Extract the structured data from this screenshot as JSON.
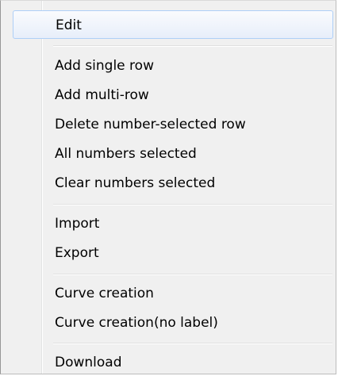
{
  "menu": {
    "items": [
      {
        "label": "Edit"
      },
      {
        "label": "Add single row"
      },
      {
        "label": "Add multi-row"
      },
      {
        "label": "Delete number-selected row"
      },
      {
        "label": "All numbers selected"
      },
      {
        "label": "Clear numbers selected"
      },
      {
        "label": "Import"
      },
      {
        "label": "Export"
      },
      {
        "label": "Curve creation"
      },
      {
        "label": "Curve creation(no label)"
      },
      {
        "label": "Download"
      }
    ],
    "highlighted_item": "Edit"
  }
}
